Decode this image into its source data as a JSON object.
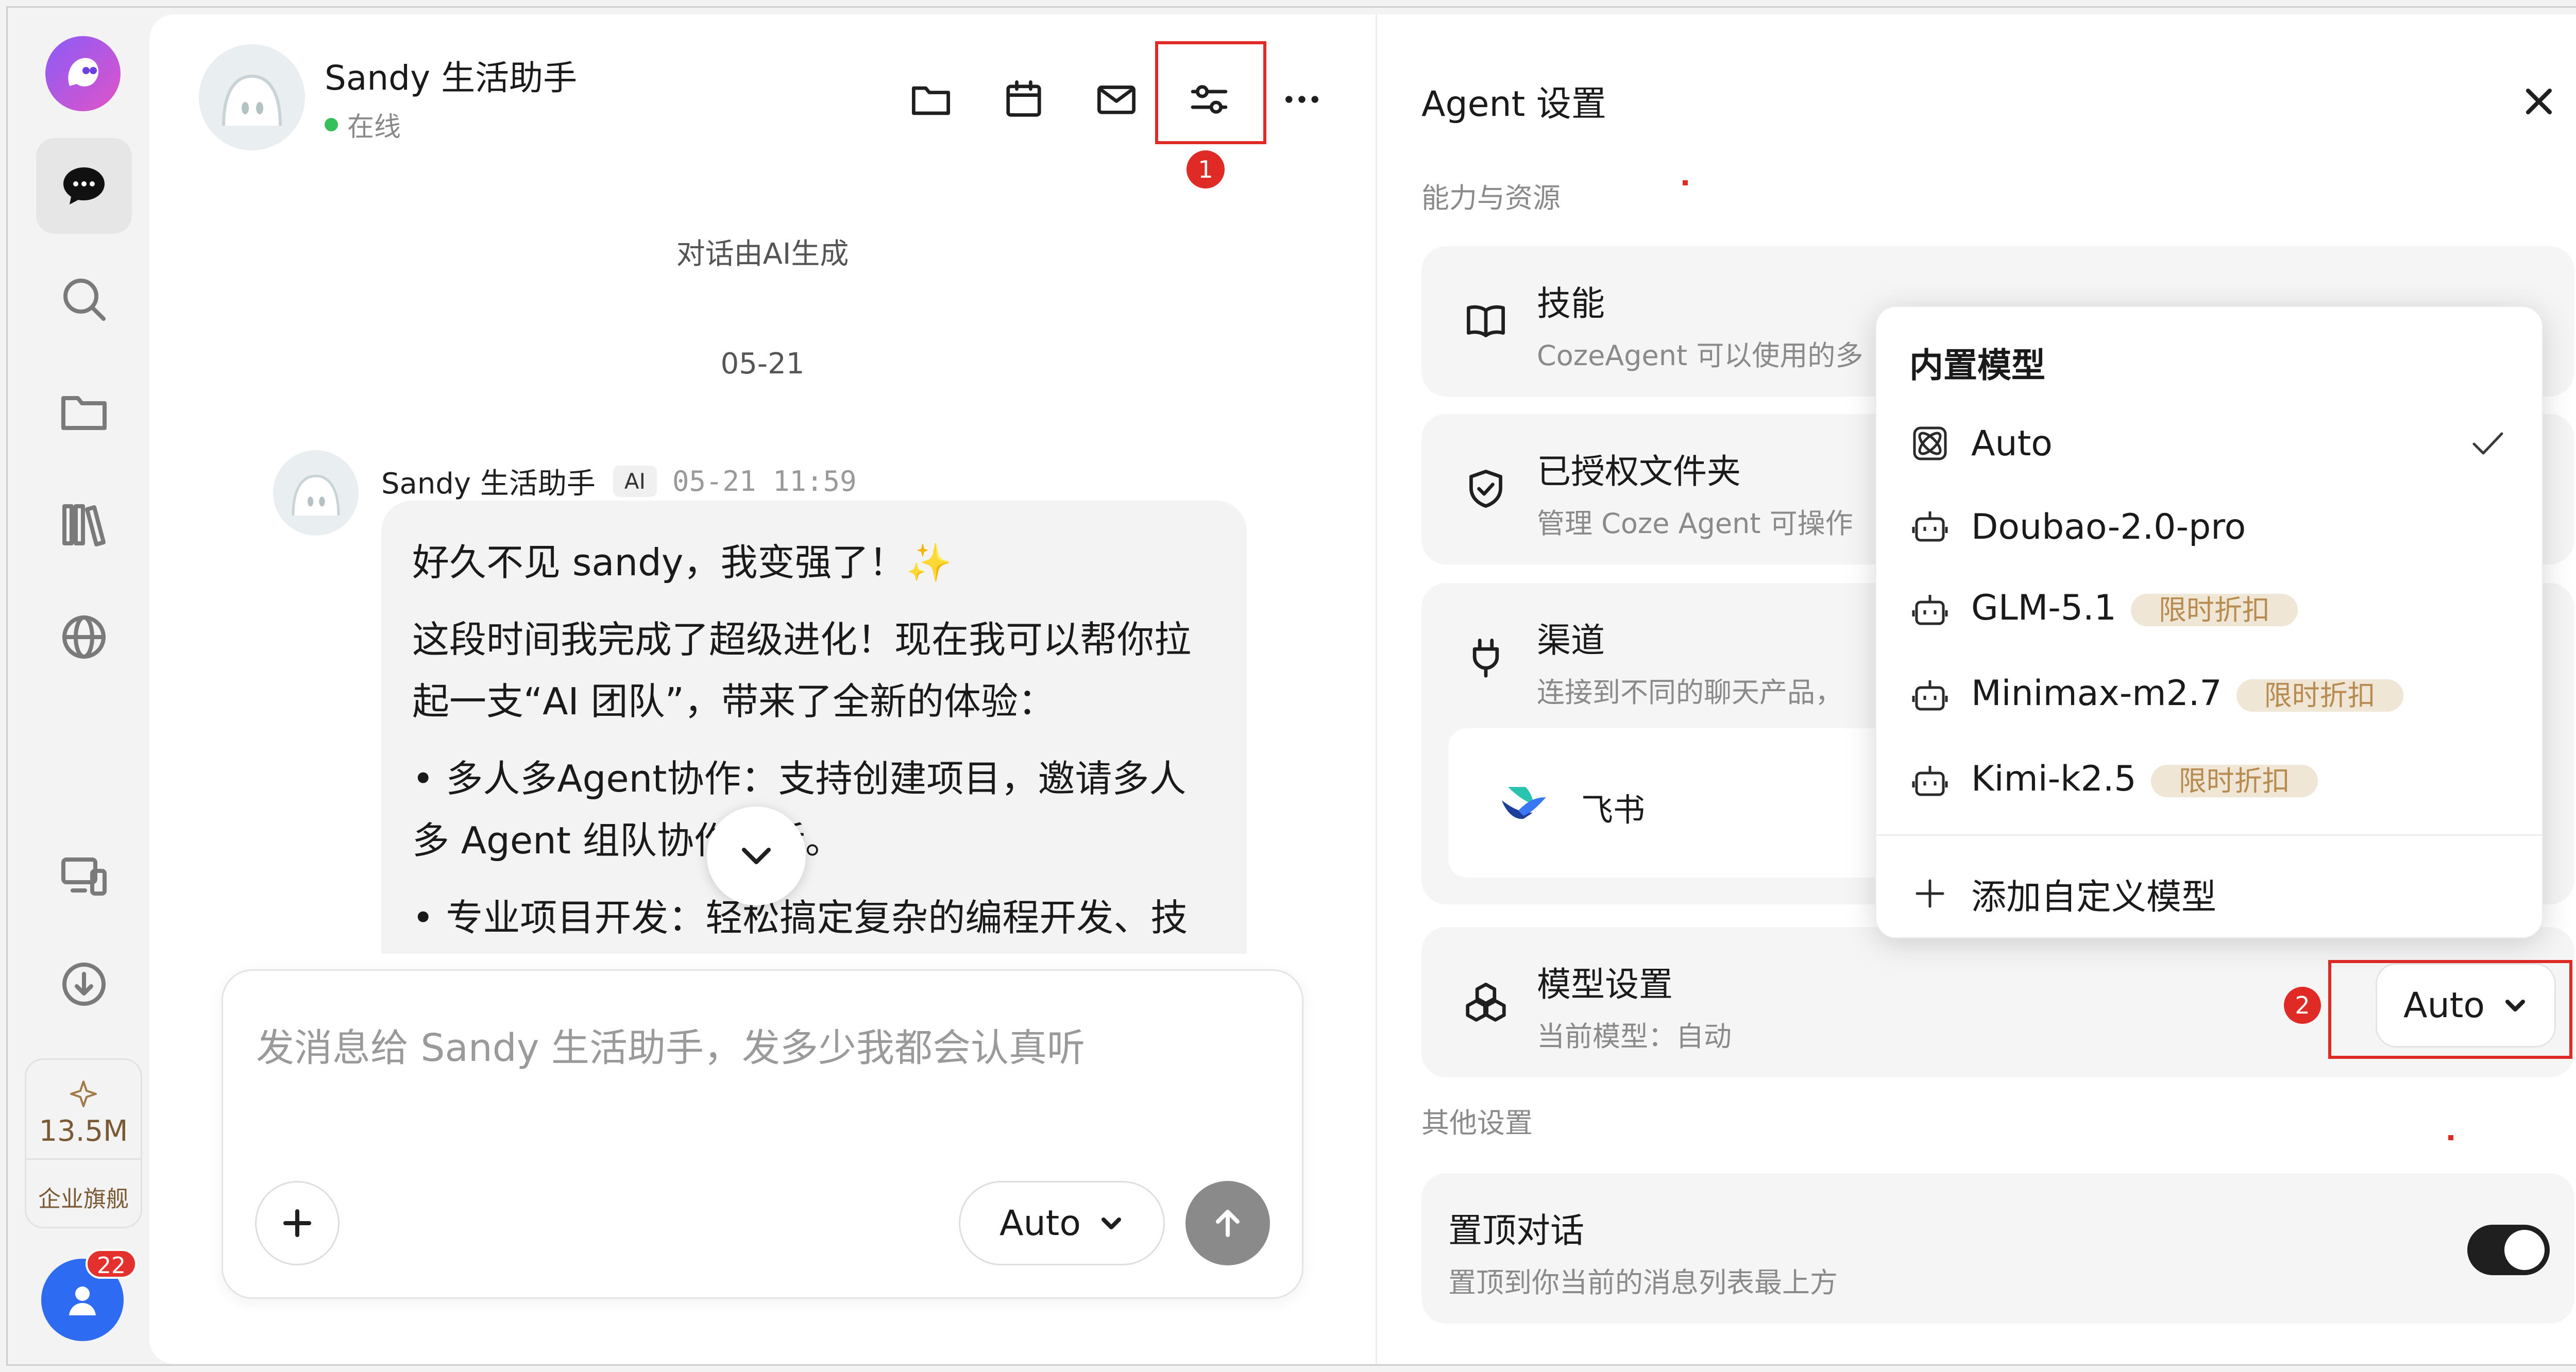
{
  "chat": {
    "agent_name": "Sandy 生活助手",
    "status": "在线",
    "ai_notice": "对话由AI生成",
    "date_divider": "05-21",
    "message": {
      "sender": "Sandy 生活助手",
      "tag": "AI",
      "time": "05-21 11:59",
      "line1": "好久不见 sandy，我变强了！✨",
      "line2": "这段时间我完成了超级进化！现在我可以帮你拉起一支“AI 团队”，带来了全新的体验：",
      "line3": "• 多人多Agent协作：支持创建项目，邀请多人多 Agent 组队协作干活。",
      "line4": "• 专业项目开发：轻松搞定复杂的编程开发、技术迭代与视频创作。"
    },
    "composer": {
      "placeholder": "发消息给 Sandy 生活助手，发多少我都会认真听",
      "model_label": "Auto"
    }
  },
  "rail": {
    "quota_value": "13.5M",
    "quota_label": "企业旗舰",
    "notifications": "22"
  },
  "annotations": {
    "step1": "1",
    "step2": "2"
  },
  "settings": {
    "title": "Agent 设置",
    "section_resources": "能力与资源",
    "section_other": "其他设置",
    "skills": {
      "title": "技能",
      "subtitle": "CozeAgent 可以使用的多"
    },
    "folders": {
      "title": "已授权文件夹",
      "subtitle": "管理 Coze Agent 可操作"
    },
    "channels": {
      "title": "渠道",
      "subtitle": "连接到不同的聊天产品，",
      "feishu": "飞书"
    },
    "model": {
      "title": "模型设置",
      "subtitle": "当前模型：自动",
      "value": "Auto"
    },
    "pin": {
      "title": "置顶对话",
      "subtitle": "置顶到你当前的消息列表最上方",
      "enabled": true
    }
  },
  "dropdown": {
    "title": "内置模型",
    "items": [
      {
        "name": "Auto",
        "selected": true,
        "tag": ""
      },
      {
        "name": "Doubao-2.0-pro",
        "tag": ""
      },
      {
        "name": "GLM-5.1",
        "tag": "限时折扣"
      },
      {
        "name": "Minimax-m2.7",
        "tag": "限时折扣"
      },
      {
        "name": "Kimi-k2.5",
        "tag": "限时折扣"
      }
    ],
    "add_custom": "添加自定义模型"
  },
  "colors": {
    "accent_red": "#e02a26",
    "brand_blue": "#2d6bf3",
    "online_green": "#35c05a",
    "discount_tag_bg": "#efe6d6",
    "discount_tag_text": "#b88b50"
  }
}
